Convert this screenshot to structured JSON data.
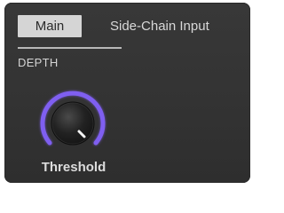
{
  "tabs": {
    "main_label": "Main",
    "side_chain_label": "Side-Chain Input",
    "active": "Main"
  },
  "section": {
    "title": "DEPTH"
  },
  "knob": {
    "label": "Threshold",
    "ring_color": "#7f5ff0",
    "indicator_icon": "white-pointer"
  },
  "colors": {
    "panel_bg": "#333333",
    "active_tab_bg": "#d5d5d5",
    "text": "#d8d8d8"
  }
}
